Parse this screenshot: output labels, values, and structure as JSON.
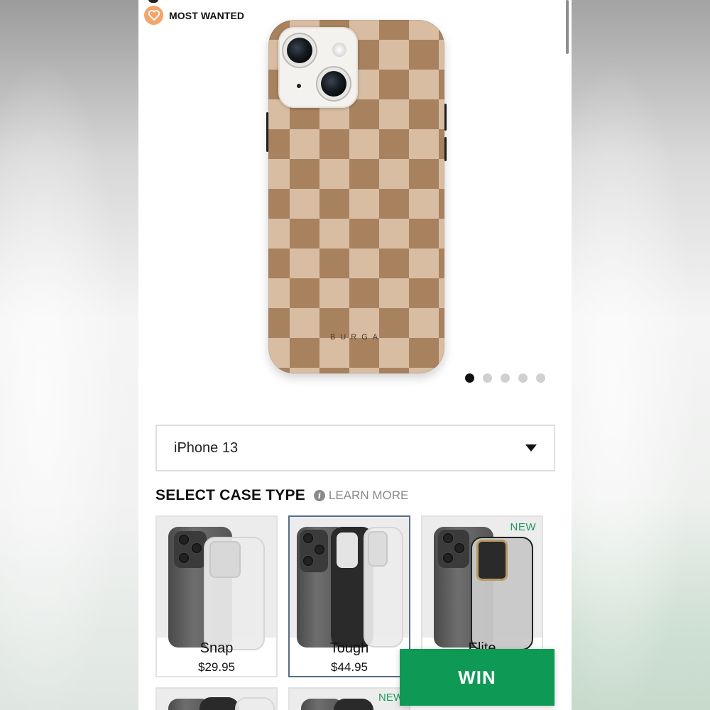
{
  "badge": {
    "label": "MOST WANTED",
    "icon": "heart-icon"
  },
  "product": {
    "brand_mark": "BURGA",
    "gallery": {
      "total": 5,
      "active_index": 0
    }
  },
  "model_select": {
    "value": "iPhone 13"
  },
  "case_type": {
    "title": "SELECT CASE TYPE",
    "learn_more": "LEARN MORE",
    "options": [
      {
        "name": "Snap",
        "price": "$29.95",
        "selected": false,
        "new_tag": ""
      },
      {
        "name": "Tough",
        "price": "$44.95",
        "selected": true,
        "new_tag": ""
      },
      {
        "name": "Elite",
        "price": "",
        "selected": false,
        "new_tag": "NEW"
      }
    ],
    "row2_new_tag": "NEW"
  },
  "cta": {
    "label": "WIN",
    "color": "#0e9a55"
  },
  "colors": {
    "accent_badge": "#f2a66c",
    "new_tag": "#1a9a5a",
    "selected_border": "#566c8a"
  }
}
